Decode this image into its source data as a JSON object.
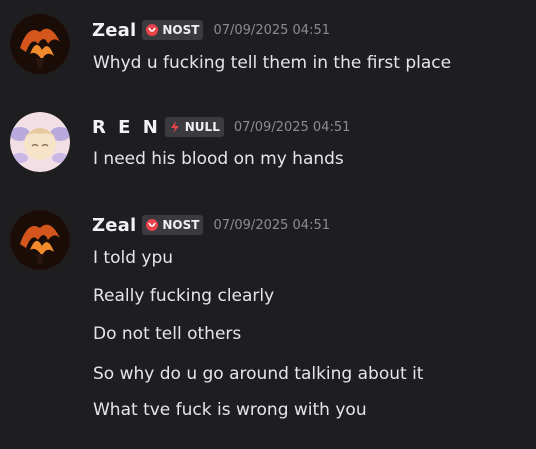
{
  "messages": [
    {
      "author": "Zeal",
      "tag": "NOST",
      "timestamp": "07/09/2025 04:51",
      "lines": [
        "Whyd u fucking tell them in the first place"
      ]
    },
    {
      "author": "R E N",
      "tag": "NULL",
      "timestamp": "07/09/2025 04:51",
      "lines": [
        "I need his blood on my hands"
      ]
    },
    {
      "author": "Zeal",
      "tag": "NOST",
      "timestamp": "07/09/2025 04:51",
      "lines": [
        "I told ypu",
        "Really fucking clearly",
        "Do not tell others",
        "So why do u go around talking about it",
        "What tve fuck is wrong with you"
      ]
    }
  ],
  "icons": {
    "nost_tag_icon": "heart-outline-icon",
    "null_tag_icon": "lightning-icon"
  },
  "colors": {
    "background": "#1e1e21",
    "tag_nost_icon": "#e8454b",
    "tag_null_icon": "#e8454b",
    "timestamp": "#8b8c93"
  }
}
